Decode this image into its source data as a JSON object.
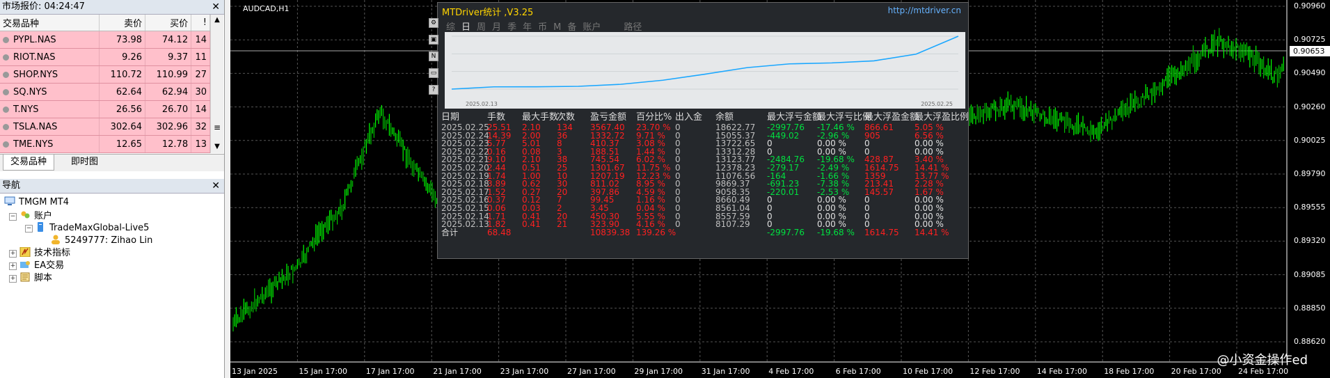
{
  "market_watch": {
    "title": "市场报价: 04:24:47",
    "columns": [
      "交易品种",
      "卖价",
      "买价",
      "!"
    ],
    "rows": [
      {
        "symbol": "PYPL.NAS",
        "bid": "73.98",
        "ask": "74.12",
        "spread": "14"
      },
      {
        "symbol": "RIOT.NAS",
        "bid": "9.26",
        "ask": "9.37",
        "spread": "11"
      },
      {
        "symbol": "SHOP.NYS",
        "bid": "110.72",
        "ask": "110.99",
        "spread": "27"
      },
      {
        "symbol": "SQ.NYS",
        "bid": "62.64",
        "ask": "62.94",
        "spread": "30"
      },
      {
        "symbol": "T.NYS",
        "bid": "26.56",
        "ask": "26.70",
        "spread": "14"
      },
      {
        "symbol": "TSLA.NAS",
        "bid": "302.64",
        "ask": "302.96",
        "spread": "32"
      },
      {
        "symbol": "TME.NYS",
        "bid": "12.65",
        "ask": "12.78",
        "spread": "13"
      }
    ],
    "tabs": [
      "交易品种",
      "即时图"
    ]
  },
  "navigator": {
    "title": "导航",
    "root": "TMGM MT4",
    "accounts": "账户",
    "server": "TradeMaxGlobal-Live5",
    "account": "5249777: Zihao Lin",
    "indicators": "技术指标",
    "experts": "EA交易",
    "scripts": "脚本"
  },
  "chart": {
    "symbol": "AUDCAD,H1",
    "price_labels": [
      "0.90960",
      "0.90725",
      "0.90490",
      "0.90260",
      "0.90025",
      "0.89790",
      "0.89555",
      "0.89320",
      "0.89085",
      "0.88850",
      "0.88620"
    ],
    "current_price": "0.90653",
    "time_labels": [
      "13 Jan 2025",
      "15 Jan 17:00",
      "17 Jan 17:00",
      "21 Jan 17:00",
      "23 Jan 17:00",
      "27 Jan 17:00",
      "29 Jan 17:00",
      "31 Jan 17:00",
      "4 Feb 17:00",
      "6 Feb 17:00",
      "10 Feb 17:00",
      "12 Feb 17:00",
      "14 Feb 17:00",
      "18 Feb 17:00",
      "20 Feb 17:00",
      "24 Feb 17:00"
    ],
    "watermark": "@小资金操作ed"
  },
  "ea_panel": {
    "title": "MTDriver统计 ,V3.25",
    "url": "http://mtdriver.cn",
    "tabs": [
      "综",
      "日",
      "周",
      "月",
      "季",
      "年",
      "币",
      "M",
      "备",
      "账户",
      "路径"
    ],
    "mini_chart": {
      "start_label": "2025.02.13",
      "end_label": "2025.02.25"
    },
    "headers": [
      "日期",
      "手数",
      "最大手数",
      "次数",
      "盈亏金额",
      "百分比%",
      "出入金",
      "余额",
      "最大浮亏金额",
      "最大浮亏比例",
      "最大浮盈金额",
      "最大浮盈比例"
    ],
    "rows": [
      {
        "date": "2025.02.25",
        "lots": "25.51",
        "maxlots": "2.10",
        "count": "134",
        "pnl": "3567.40",
        "pct": "23.70 %",
        "io": "0",
        "bal": "18622.77",
        "mdd": "-2997.76",
        "mddp": "-17.46 %",
        "mfe": "866.61",
        "mfep": "5.05 %"
      },
      {
        "date": "2025.02.24",
        "lots": "14.39",
        "maxlots": "2.00",
        "count": "36",
        "pnl": "1332.72",
        "pct": "9.71 %",
        "io": "0",
        "bal": "15055.37",
        "mdd": "-449.02",
        "mddp": "-2.96 %",
        "mfe": "905",
        "mfep": "6.56 %"
      },
      {
        "date": "2025.02.23",
        "lots": "5.77",
        "maxlots": "5.01",
        "count": "8",
        "pnl": "410.37",
        "pct": "3.08 %",
        "io": "0",
        "bal": "13722.65",
        "mdd": "0",
        "mddp": "0.00 %",
        "mfe": "0",
        "mfep": "0.00 %"
      },
      {
        "date": "2025.02.22",
        "lots": "0.16",
        "maxlots": "0.08",
        "count": "3",
        "pnl": "188.51",
        "pct": "1.44 %",
        "io": "0",
        "bal": "13312.28",
        "mdd": "0",
        "mddp": "0.00 %",
        "mfe": "0",
        "mfep": "0.00 %"
      },
      {
        "date": "2025.02.21",
        "lots": "9.10",
        "maxlots": "2.10",
        "count": "38",
        "pnl": "745.54",
        "pct": "6.02 %",
        "io": "0",
        "bal": "13123.77",
        "mdd": "-2484.76",
        "mddp": "-19.68 %",
        "mfe": "428.87",
        "mfep": "3.40 %"
      },
      {
        "date": "2025.02.20",
        "lots": "2.44",
        "maxlots": "0.51",
        "count": "25",
        "pnl": "1301.67",
        "pct": "11.75 %",
        "io": "0",
        "bal": "12378.23",
        "mdd": "-279.17",
        "mddp": "-2.49 %",
        "mfe": "1614.75",
        "mfep": "14.41 %"
      },
      {
        "date": "2025.02.19",
        "lots": "1.74",
        "maxlots": "1.00",
        "count": "10",
        "pnl": "1207.19",
        "pct": "12.23 %",
        "io": "0",
        "bal": "11076.56",
        "mdd": "-164",
        "mddp": "-1.66 %",
        "mfe": "1359",
        "mfep": "13.77 %"
      },
      {
        "date": "2025.02.18",
        "lots": "3.89",
        "maxlots": "0.62",
        "count": "30",
        "pnl": "811.02",
        "pct": "8.95 %",
        "io": "0",
        "bal": "9869.37",
        "mdd": "-691.23",
        "mddp": "-7.38 %",
        "mfe": "213.41",
        "mfep": "2.28 %"
      },
      {
        "date": "2025.02.17",
        "lots": "1.52",
        "maxlots": "0.27",
        "count": "20",
        "pnl": "397.86",
        "pct": "4.59 %",
        "io": "0",
        "bal": "9058.35",
        "mdd": "-220.01",
        "mddp": "-2.53 %",
        "mfe": "145.57",
        "mfep": "1.67 %"
      },
      {
        "date": "2025.02.16",
        "lots": "0.37",
        "maxlots": "0.12",
        "count": "7",
        "pnl": "99.45",
        "pct": "1.16 %",
        "io": "0",
        "bal": "8660.49",
        "mdd": "0",
        "mddp": "0.00 %",
        "mfe": "0",
        "mfep": "0.00 %"
      },
      {
        "date": "2025.02.15",
        "lots": "0.06",
        "maxlots": "0.03",
        "count": "2",
        "pnl": "3.45",
        "pct": "0.04 %",
        "io": "0",
        "bal": "8561.04",
        "mdd": "0",
        "mddp": "0.00 %",
        "mfe": "0",
        "mfep": "0.00 %"
      },
      {
        "date": "2025.02.14",
        "lots": "1.71",
        "maxlots": "0.41",
        "count": "20",
        "pnl": "450.30",
        "pct": "5.55 %",
        "io": "0",
        "bal": "8557.59",
        "mdd": "0",
        "mddp": "0.00 %",
        "mfe": "0",
        "mfep": "0.00 %"
      },
      {
        "date": "2025.02.13",
        "lots": "1.82",
        "maxlots": "0.41",
        "count": "21",
        "pnl": "323.90",
        "pct": "4.16 %",
        "io": "0",
        "bal": "8107.29",
        "mdd": "0",
        "mddp": "0.00 %",
        "mfe": "0",
        "mfep": "0.00 %"
      }
    ],
    "total": {
      "label": "合计",
      "lots": "68.48",
      "pnl": "10839.38",
      "pct": "139.26 %",
      "mdd": "-2997.76",
      "mddp": "-19.68 %",
      "mfe": "1614.75",
      "mfep": "14.41 %"
    }
  },
  "colors": {
    "pink_row": "#ffc0cb",
    "candle_up": "#00ff00",
    "ea_title": "#ffd400",
    "loss": "#ff2020",
    "profit_drawdown": "#00e040",
    "equity_line": "#1aa7ff"
  }
}
